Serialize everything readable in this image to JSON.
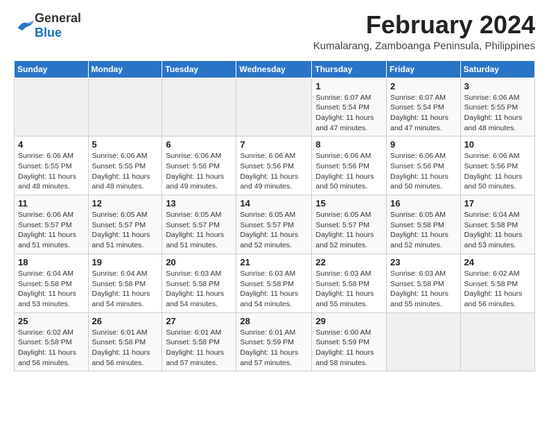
{
  "logo": {
    "general": "General",
    "blue": "Blue"
  },
  "header": {
    "month": "February 2024",
    "location": "Kumalarang, Zamboanga Peninsula, Philippines"
  },
  "weekdays": [
    "Sunday",
    "Monday",
    "Tuesday",
    "Wednesday",
    "Thursday",
    "Friday",
    "Saturday"
  ],
  "weeks": [
    [
      {
        "day": "",
        "info": ""
      },
      {
        "day": "",
        "info": ""
      },
      {
        "day": "",
        "info": ""
      },
      {
        "day": "",
        "info": ""
      },
      {
        "day": "1",
        "info": "Sunrise: 6:07 AM\nSunset: 5:54 PM\nDaylight: 11 hours and 47 minutes."
      },
      {
        "day": "2",
        "info": "Sunrise: 6:07 AM\nSunset: 5:54 PM\nDaylight: 11 hours and 47 minutes."
      },
      {
        "day": "3",
        "info": "Sunrise: 6:06 AM\nSunset: 5:55 PM\nDaylight: 11 hours and 48 minutes."
      }
    ],
    [
      {
        "day": "4",
        "info": "Sunrise: 6:06 AM\nSunset: 5:55 PM\nDaylight: 11 hours and 48 minutes."
      },
      {
        "day": "5",
        "info": "Sunrise: 6:06 AM\nSunset: 5:55 PM\nDaylight: 11 hours and 48 minutes."
      },
      {
        "day": "6",
        "info": "Sunrise: 6:06 AM\nSunset: 5:56 PM\nDaylight: 11 hours and 49 minutes."
      },
      {
        "day": "7",
        "info": "Sunrise: 6:06 AM\nSunset: 5:56 PM\nDaylight: 11 hours and 49 minutes."
      },
      {
        "day": "8",
        "info": "Sunrise: 6:06 AM\nSunset: 5:56 PM\nDaylight: 11 hours and 50 minutes."
      },
      {
        "day": "9",
        "info": "Sunrise: 6:06 AM\nSunset: 5:56 PM\nDaylight: 11 hours and 50 minutes."
      },
      {
        "day": "10",
        "info": "Sunrise: 6:06 AM\nSunset: 5:56 PM\nDaylight: 11 hours and 50 minutes."
      }
    ],
    [
      {
        "day": "11",
        "info": "Sunrise: 6:06 AM\nSunset: 5:57 PM\nDaylight: 11 hours and 51 minutes."
      },
      {
        "day": "12",
        "info": "Sunrise: 6:05 AM\nSunset: 5:57 PM\nDaylight: 11 hours and 51 minutes."
      },
      {
        "day": "13",
        "info": "Sunrise: 6:05 AM\nSunset: 5:57 PM\nDaylight: 11 hours and 51 minutes."
      },
      {
        "day": "14",
        "info": "Sunrise: 6:05 AM\nSunset: 5:57 PM\nDaylight: 11 hours and 52 minutes."
      },
      {
        "day": "15",
        "info": "Sunrise: 6:05 AM\nSunset: 5:57 PM\nDaylight: 11 hours and 52 minutes."
      },
      {
        "day": "16",
        "info": "Sunrise: 6:05 AM\nSunset: 5:58 PM\nDaylight: 11 hours and 52 minutes."
      },
      {
        "day": "17",
        "info": "Sunrise: 6:04 AM\nSunset: 5:58 PM\nDaylight: 11 hours and 53 minutes."
      }
    ],
    [
      {
        "day": "18",
        "info": "Sunrise: 6:04 AM\nSunset: 5:58 PM\nDaylight: 11 hours and 53 minutes."
      },
      {
        "day": "19",
        "info": "Sunrise: 6:04 AM\nSunset: 5:58 PM\nDaylight: 11 hours and 54 minutes."
      },
      {
        "day": "20",
        "info": "Sunrise: 6:03 AM\nSunset: 5:58 PM\nDaylight: 11 hours and 54 minutes."
      },
      {
        "day": "21",
        "info": "Sunrise: 6:03 AM\nSunset: 5:58 PM\nDaylight: 11 hours and 54 minutes."
      },
      {
        "day": "22",
        "info": "Sunrise: 6:03 AM\nSunset: 5:58 PM\nDaylight: 11 hours and 55 minutes."
      },
      {
        "day": "23",
        "info": "Sunrise: 6:03 AM\nSunset: 5:58 PM\nDaylight: 11 hours and 55 minutes."
      },
      {
        "day": "24",
        "info": "Sunrise: 6:02 AM\nSunset: 5:58 PM\nDaylight: 11 hours and 56 minutes."
      }
    ],
    [
      {
        "day": "25",
        "info": "Sunrise: 6:02 AM\nSunset: 5:58 PM\nDaylight: 11 hours and 56 minutes."
      },
      {
        "day": "26",
        "info": "Sunrise: 6:01 AM\nSunset: 5:58 PM\nDaylight: 11 hours and 56 minutes."
      },
      {
        "day": "27",
        "info": "Sunrise: 6:01 AM\nSunset: 5:58 PM\nDaylight: 11 hours and 57 minutes."
      },
      {
        "day": "28",
        "info": "Sunrise: 6:01 AM\nSunset: 5:59 PM\nDaylight: 11 hours and 57 minutes."
      },
      {
        "day": "29",
        "info": "Sunrise: 6:00 AM\nSunset: 5:59 PM\nDaylight: 11 hours and 58 minutes."
      },
      {
        "day": "",
        "info": ""
      },
      {
        "day": "",
        "info": ""
      }
    ]
  ]
}
